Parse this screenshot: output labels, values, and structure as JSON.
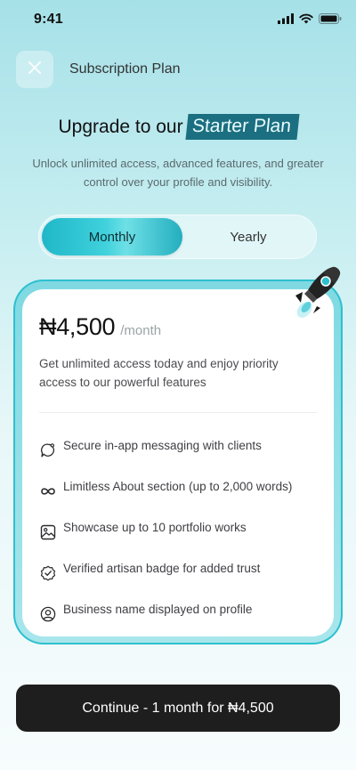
{
  "status_bar": {
    "time": "9:41",
    "icons": [
      "signal-icon",
      "wifi-icon",
      "battery-icon"
    ]
  },
  "header": {
    "close_icon": "close-icon",
    "title": "Subscription Plan"
  },
  "hero": {
    "title_prefix": "Upgrade to our",
    "plan_name": "Starter Plan",
    "subtitle": "Unlock unlimited access, advanced features, and greater control over your profile and visibility."
  },
  "billing_toggle": {
    "options": [
      "Monthly",
      "Yearly"
    ],
    "selected": "Monthly"
  },
  "plan": {
    "price": "₦4,500",
    "period": "/month",
    "description": "Get unlimited access today and enjoy priority access to our powerful features",
    "illustration": "rocket-icon",
    "features": [
      {
        "icon": "chat-bubble-icon",
        "label": "Secure in-app messaging with clients"
      },
      {
        "icon": "infinity-icon",
        "label": "Limitless About section (up to 2,000 words)"
      },
      {
        "icon": "image-icon",
        "label": "Showcase up to 10 portfolio works"
      },
      {
        "icon": "verified-badge-icon",
        "label": "Verified artisan badge for added trust"
      },
      {
        "icon": "user-circle-icon",
        "label": "Business name displayed on profile"
      }
    ]
  },
  "cta": {
    "label": "Continue  - 1 month for ₦4,500"
  },
  "colors": {
    "accent": "#2ec0cf",
    "badge_bg": "#1b6f80",
    "cta_bg": "#1e1e1e"
  }
}
